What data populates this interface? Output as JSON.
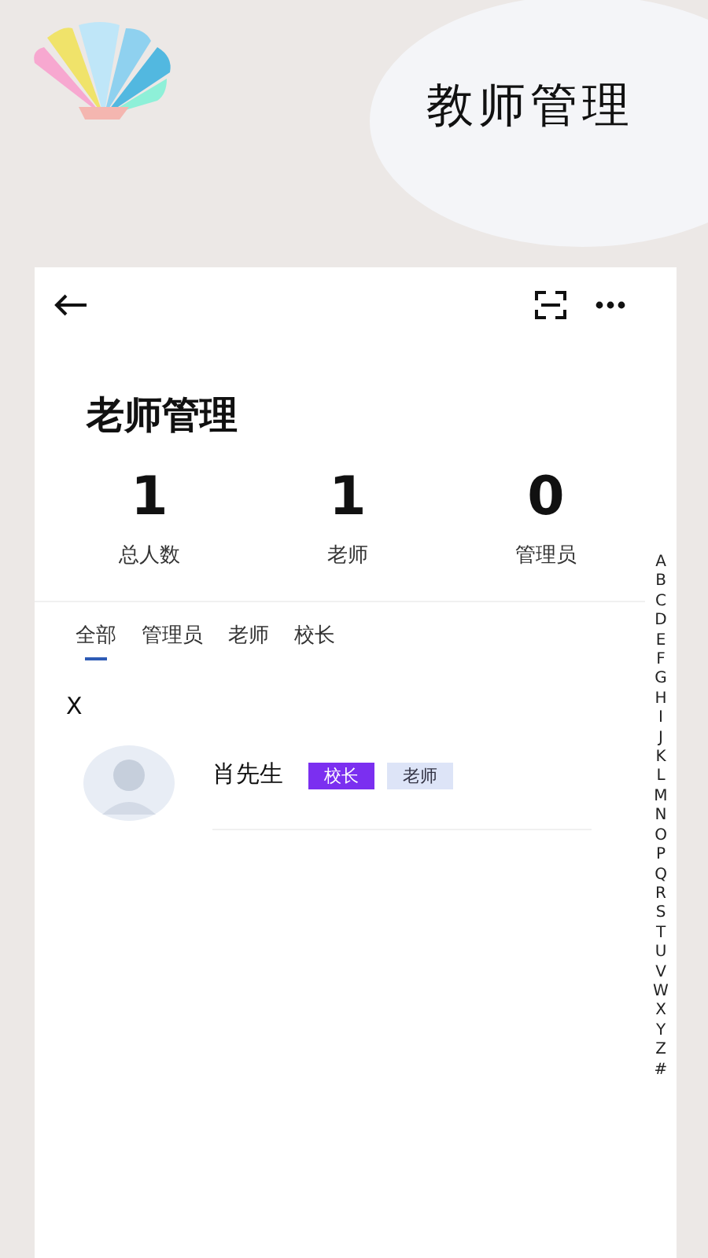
{
  "header": {
    "title": "教师管理"
  },
  "page": {
    "title": "老师管理"
  },
  "stats": [
    {
      "value": "1",
      "label": "总人数"
    },
    {
      "value": "1",
      "label": "老师"
    },
    {
      "value": "0",
      "label": "管理员"
    }
  ],
  "tabs": [
    {
      "label": "全部",
      "selected": true
    },
    {
      "label": "管理员",
      "selected": false
    },
    {
      "label": "老师",
      "selected": false
    },
    {
      "label": "校长",
      "selected": false
    }
  ],
  "groups": [
    {
      "letter": "X",
      "members": [
        {
          "name": "肖先生",
          "tags": [
            {
              "label": "校长",
              "color": "#7b2ff0"
            },
            {
              "label": "老师",
              "color": "#dde4f7"
            }
          ]
        }
      ]
    }
  ],
  "index": [
    "A",
    "B",
    "C",
    "D",
    "E",
    "F",
    "G",
    "H",
    "I",
    "J",
    "K",
    "L",
    "M",
    "N",
    "O",
    "P",
    "Q",
    "R",
    "S",
    "T",
    "U",
    "V",
    "W",
    "X",
    "Y",
    "Z",
    "#"
  ]
}
